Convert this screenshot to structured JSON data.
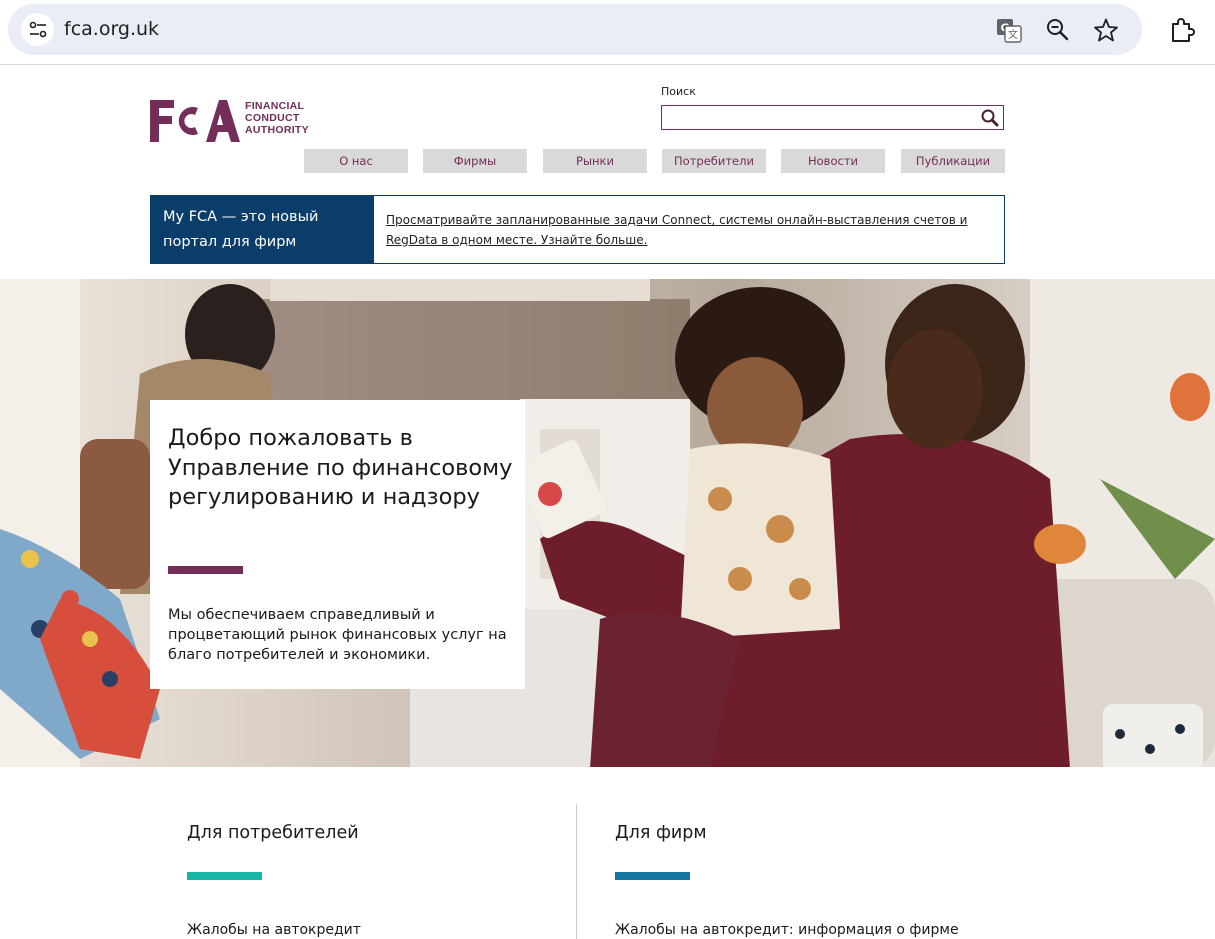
{
  "browser": {
    "url": "fca.org.uk"
  },
  "logo": {
    "letters": "FCA",
    "line1": "FINANCIAL",
    "line2": "CONDUCT",
    "line3": "AUTHORITY"
  },
  "search": {
    "label": "Поиск",
    "value": ""
  },
  "nav": [
    {
      "label": "О нас"
    },
    {
      "label": "Фирмы"
    },
    {
      "label": "Рынки"
    },
    {
      "label": "Потребители"
    },
    {
      "label": "Новости"
    },
    {
      "label": "Публикации"
    }
  ],
  "banner": {
    "heading": "My FCA — это новый портал для фирм",
    "link": "Просматривайте запланированные задачи Connect, системы онлайн-выставления счетов и RegData в одном месте. Узнайте больше."
  },
  "hero": {
    "title": "Добро пожаловать в Управление по финансовому регулированию и надзору",
    "description": "Мы обеспечиваем справедливый и процветающий рынок финансовых услуг на благо потребителей и экономики."
  },
  "sections": [
    {
      "title": "Для потребителей",
      "link": "Жалобы на автокредит",
      "accent": "#17b5a8"
    },
    {
      "title": "Для фирм",
      "link": "Жалобы на автокредит: информация о фирме",
      "accent": "#1478a0"
    }
  ],
  "colors": {
    "brand": "#722d59",
    "banner_blue": "#0b3d6b",
    "nav_bg": "#d9d9d9"
  }
}
